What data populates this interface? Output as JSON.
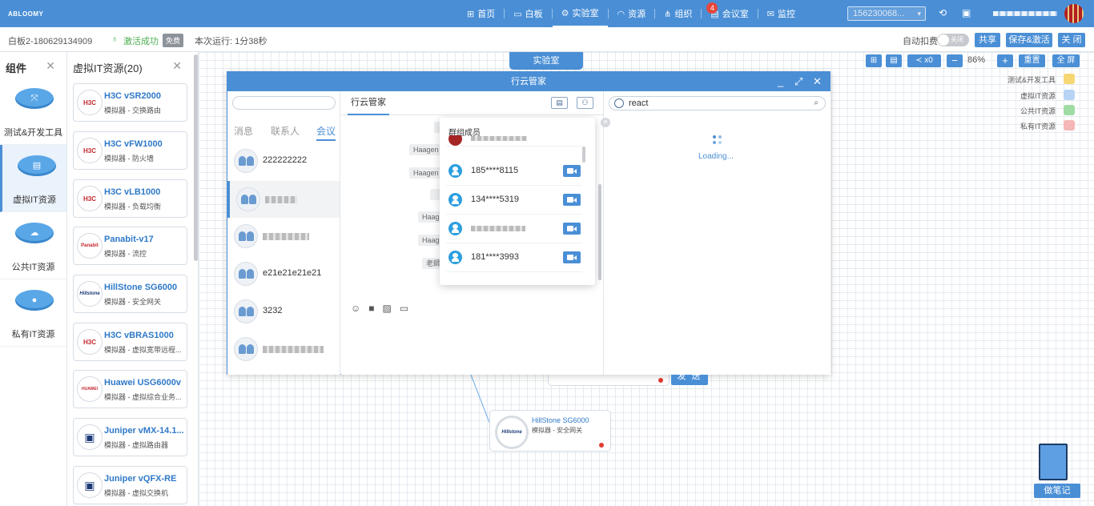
{
  "top": {
    "logo": "ABLOOMY",
    "nav": [
      {
        "label": "首页",
        "icon": "grid-icon",
        "active": false
      },
      {
        "label": "白板",
        "icon": "monitor-icon",
        "active": false
      },
      {
        "label": "实验室",
        "icon": "gear-icon",
        "active": true
      },
      {
        "label": "资源",
        "icon": "wifi-icon",
        "active": false
      },
      {
        "label": "组织",
        "icon": "org-icon",
        "active": false
      },
      {
        "label": "会议室",
        "icon": "meeting-icon",
        "active": false,
        "badge": "4"
      },
      {
        "label": "监控",
        "icon": "mail-icon",
        "active": false
      }
    ],
    "phone": "156230068..."
  },
  "sub": {
    "board": "白板2-180629134909",
    "status": "激活成功",
    "free": "免费",
    "runtime": "本次运行: 1分38秒",
    "autobill": "自动扣费",
    "toggle": "关闭",
    "share": "共享",
    "save": "保存&激活",
    "close": "关 闭"
  },
  "left1": {
    "title": "组件",
    "cats": [
      {
        "label": "测试&开发工具"
      },
      {
        "label": "虚拟IT资源"
      },
      {
        "label": "公共IT资源"
      },
      {
        "label": "私有IT资源"
      }
    ]
  },
  "left2": {
    "title": "虚拟IT资源(20)",
    "items": [
      {
        "name": "H3C vSR2000",
        "desc": "模拟器 - 交换路由",
        "logo": "H3C"
      },
      {
        "name": "H3C vFW1000",
        "desc": "模拟器 - 防火墙",
        "logo": "H3C"
      },
      {
        "name": "H3C vLB1000",
        "desc": "模拟器 - 负载均衡",
        "logo": "H3C"
      },
      {
        "name": "Panabit-v17",
        "desc": "模拟器 - 流控",
        "logo": "Panabit"
      },
      {
        "name": "HillStone SG6000",
        "desc": "模拟器 - 安全网关",
        "logo": "Hillstone"
      },
      {
        "name": "H3C vBRAS1000",
        "desc": "模拟器 - 虚拟宽带远程...",
        "logo": "H3C"
      },
      {
        "name": "Huawei USG6000v",
        "desc": "模拟器 - 虚拟综合业务...",
        "logo": "HUAWEI"
      },
      {
        "name": "Juniper vMX-14.1...",
        "desc": "模拟器 - 虚拟路由器",
        "logo": "▣"
      },
      {
        "name": "Juniper vQFX-RE",
        "desc": "模拟器 - 虚拟交换机",
        "logo": "▣"
      }
    ]
  },
  "canvas": {
    "lab_tab": "实验室",
    "share_count": "x0",
    "zoom": "86%",
    "reset": "重置",
    "fullscreen": "全 屏",
    "legend": [
      {
        "label": "测试&开发工具",
        "color": "#f7d774"
      },
      {
        "label": "虚拟IT资源",
        "color": "#b7d3f5"
      },
      {
        "label": "公共IT资源",
        "color": "#9fdca4"
      },
      {
        "label": "私有IT资源",
        "color": "#f5b7b7"
      }
    ],
    "node": {
      "name": "HillStone SG6000",
      "desc": "模拟器 - 安全网关",
      "logo": "Hillstone"
    },
    "note": "做笔记"
  },
  "dialog": {
    "title": "行云管家",
    "tabs": [
      "消息",
      "联系人",
      "会议"
    ],
    "convs": [
      "222222222",
      "",
      "",
      "e21e21e21e21",
      "3232",
      ""
    ],
    "chat_tab": "行云管家",
    "msgs": [
      "",
      "Haagen",
      "Haagen",
      "",
      "Haag",
      "Haag",
      "老師"
    ],
    "send": "发 送",
    "browser_url": "react",
    "loading": "Loading..."
  },
  "popup": {
    "title": "群组成员",
    "members": [
      "185****8115",
      "134****5319",
      "",
      "181****3993"
    ]
  }
}
